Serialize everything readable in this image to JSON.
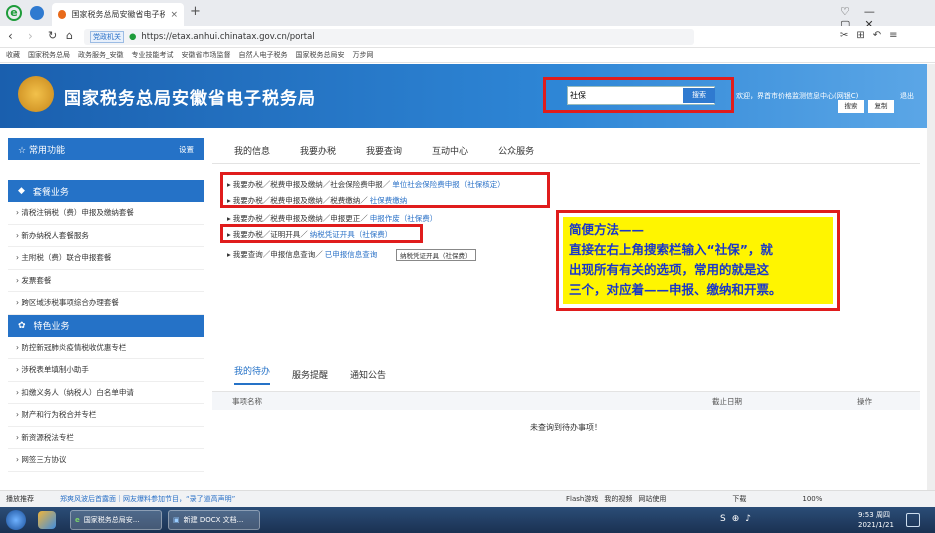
{
  "browser": {
    "tab_title": "国家税务总局安徽省电子税务局",
    "add_tab": "+",
    "url_domain": "党政机关",
    "url": "https://etax.anhui.chinatax.gov.cn/portal",
    "bookmarks": [
      "收藏",
      "国家税务总局",
      "政务服务_安徽",
      "专业技能考试",
      "安徽省市场监督",
      "自然人电子税务",
      "国家税务总局安",
      "万步网"
    ]
  },
  "header": {
    "site_title": "国家税务总局安徽省电子税务局",
    "search_value": "社保",
    "search_button": "搜索",
    "welcome": "欢迎，界首市价格监测信息中心(网银C)",
    "logout": "退出",
    "btn_search": "搜索",
    "btn_copy": "复制"
  },
  "sidebar": {
    "common": "常用功能",
    "settings": "设置",
    "package": "套餐业务",
    "package_items": [
      "清税注销税（费）申报及缴纳套餐",
      "新办纳税人套餐服务",
      "主附税（费）联合申报套餐",
      "发票套餐",
      "跨区域涉税事项综合办理套餐"
    ],
    "special": "特色业务",
    "special_items": [
      "防控新冠肺炎疫情税收优惠专栏",
      "涉税表单填制小助手",
      "扣缴义务人（纳税人）白名单申请",
      "财产和行为税合并专栏",
      "新资源税法专栏",
      "网签三方协议"
    ]
  },
  "main": {
    "tabs": [
      "我的信息",
      "我要办税",
      "我要查询",
      "互动中心",
      "公众服务"
    ],
    "results": [
      {
        "path": "我要办税／税费申报及缴纳／社会保险费申报／",
        "link": "单位社会保险费申报（社保核定）"
      },
      {
        "path": "我要办税／税费申报及缴纳／税费缴纳／",
        "link": "社保费缴纳"
      },
      {
        "path": "我要办税／税费申报及缴纳／申报更正／",
        "link": "申报作废（社保费）"
      },
      {
        "path": "我要办税／证明开具／",
        "link": "纳税凭证开具（社保费）"
      },
      {
        "path": "我要查询／申报信息查询／",
        "link": "已申报信息查询"
      }
    ],
    "tooltip": "纳税凭证开具（社保费）"
  },
  "note": {
    "line1": "简便方法——",
    "line2": "直接在右上角搜索栏输入“社保”，就",
    "line3": "出现所有有关的选项，常用的就是这",
    "line4": "三个，对应着——申报、缴纳和开票。"
  },
  "todo": {
    "tabs": [
      "我的待办",
      "服务提醒",
      "通知公告"
    ],
    "col_name": "事项名称",
    "col_date": "截止日期",
    "col_action": "操作",
    "empty": "未查询到待办事项！"
  },
  "statusbar": {
    "left1": "播放推荐",
    "news": "郑爽风波后首露面｜网友爆料参加节目，“录了道高声明”",
    "items": [
      "Flash游戏",
      "我的视频",
      "网站使用",
      "下载"
    ],
    "zoom": "100%"
  },
  "taskbar": {
    "task1": "国家税务总局安...",
    "task2": "新建 DOCX 文档...",
    "time": "9:53 周四",
    "date": "2021/1/21"
  },
  "colors": {
    "accent": "#2572c7",
    "highlight": "#fff500",
    "red": "#e01c1c"
  }
}
